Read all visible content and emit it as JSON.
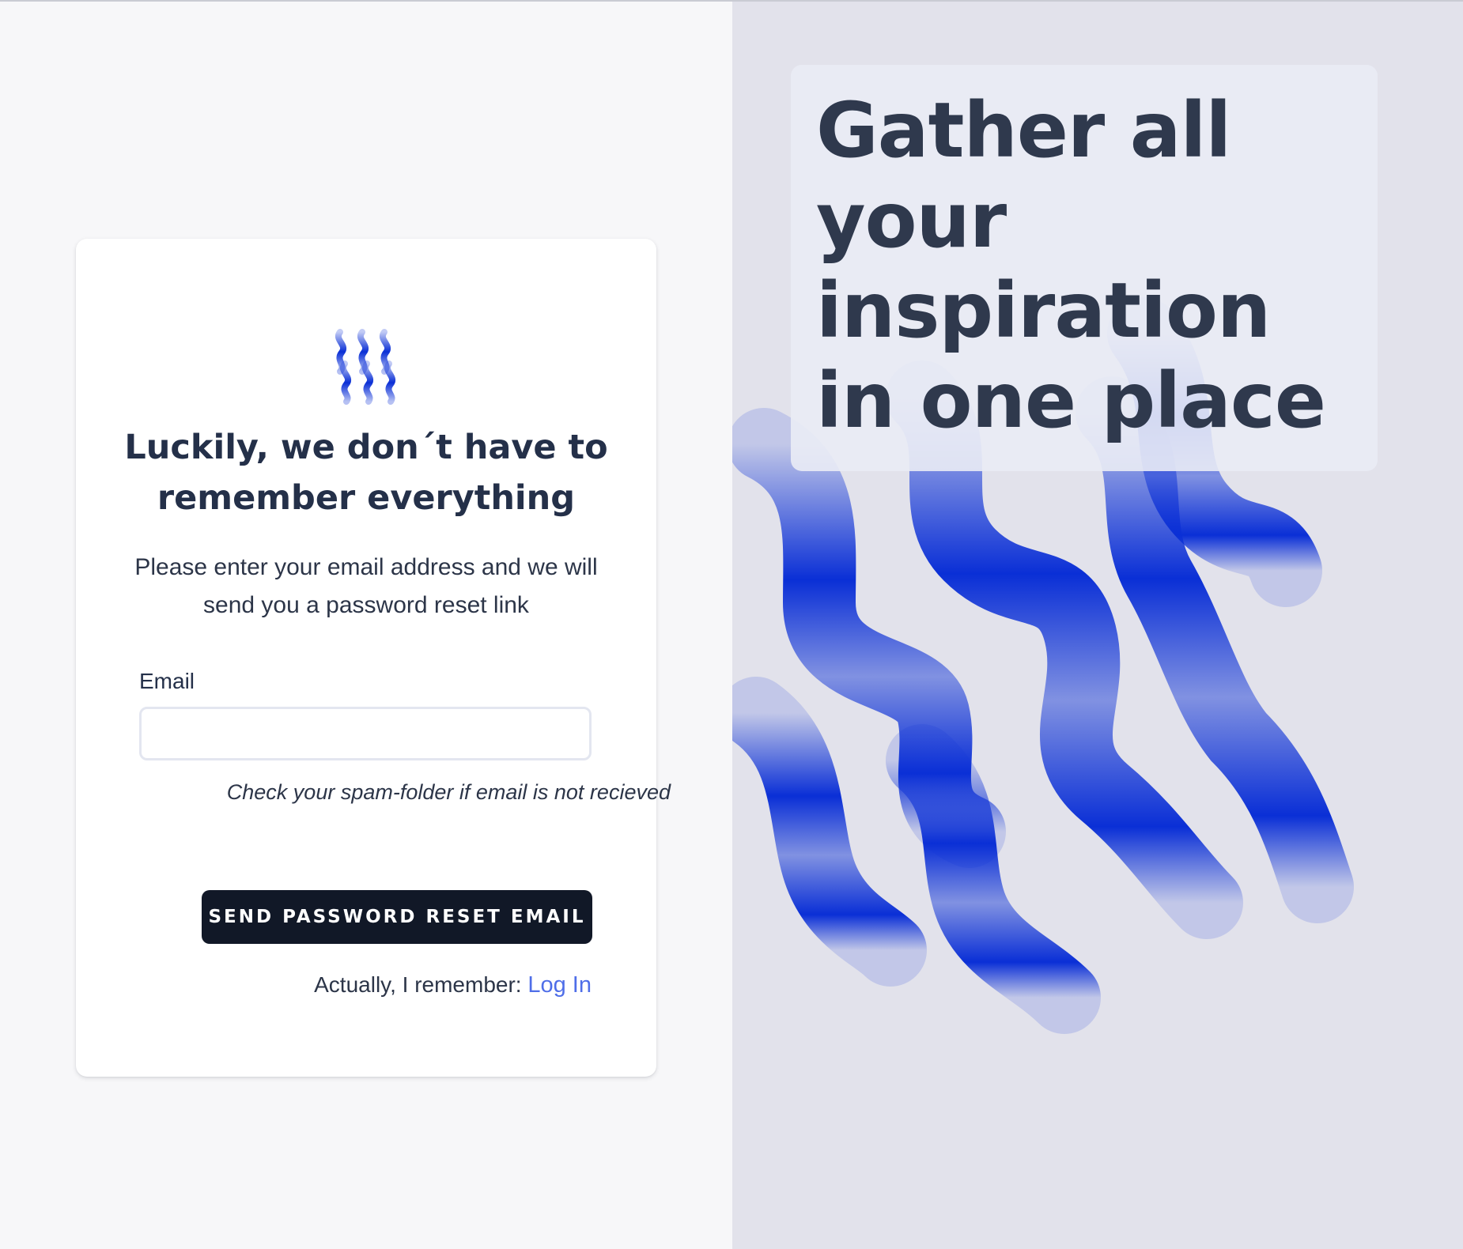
{
  "card": {
    "logo_icon": "wavy-lines-logo-icon",
    "heading": "Luckily, we don´t have to remember everything",
    "subtitle": "Please enter your email address and we will send you a password reset link",
    "email_label": "Email",
    "email_value": "",
    "hint": "Check your spam-folder if email is not recieved",
    "send_button": "SEND PASSWORD RESET EMAIL",
    "login_prompt": "Actually, I remember: ",
    "login_link": "Log In"
  },
  "hero": {
    "headline": "Gather all your inspiration in one place",
    "decoration_icon": "wavy-lines-pattern"
  },
  "colors": {
    "button_bg": "#111827",
    "link": "#4f6ee8",
    "accent_blue": "#0a2fd6",
    "heading_text": "#243049",
    "right_panel_bg": "#e2e2eb"
  }
}
